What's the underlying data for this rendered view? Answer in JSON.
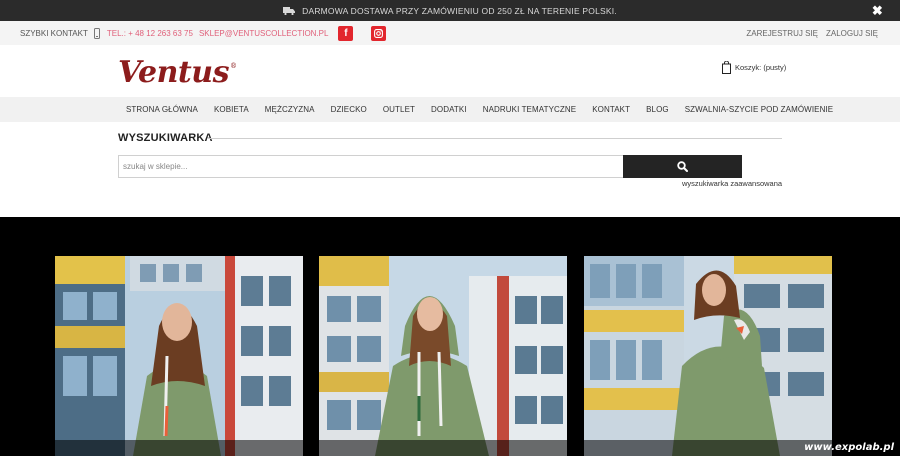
{
  "promo": {
    "text": "DARMOWA DOSTAWA PRZY ZAMÓWIENIU OD 250 ZŁ NA TERENIE POLSKI.",
    "close_glyph": "✖"
  },
  "topbar": {
    "quick_contact": "SZYBKI KONTAKT",
    "phone": "TEL.: + 48 12 263 63 75",
    "email": "SKLEP@VENTUSCOLLECTION.PL",
    "facebook_glyph": "f",
    "register": "ZAREJESTRUJ SIĘ",
    "login": "ZALOGUJ SIĘ"
  },
  "header": {
    "logo_text": "Ventus",
    "logo_mark": "®",
    "cart_label": "Koszyk: (pusty)"
  },
  "nav": {
    "items": [
      "STRONA GŁÓWNA",
      "KOBIETA",
      "MĘŻCZYZNA",
      "DZIECKO",
      "OUTLET",
      "DODATKI",
      "NADRUKI TEMATYCZNE",
      "KONTAKT",
      "BLOG",
      "SZWALNIA-SZYCIE POD ZAMÓWIENIE"
    ]
  },
  "search": {
    "title": "WYSZUKIWARKA",
    "placeholder": "szukaj w sklepie...",
    "value": "",
    "advanced_link": "wyszukiwarka zaawansowana"
  },
  "watermark": "www.expolab.pl",
  "colors": {
    "promo_bg": "#2b2b2b",
    "accent_pink": "#e0607a",
    "logo_red": "#8c1c1c",
    "social_red": "#e2262d",
    "gallery_bg": "#000000",
    "hoodie_green": "#7f9a6c"
  },
  "icons": {
    "promo": "truck-icon",
    "close": "close-icon",
    "phone": "phone-icon",
    "facebook": "facebook-icon",
    "instagram": "instagram-icon",
    "cart": "shopping-bag-icon",
    "search": "search-icon"
  }
}
